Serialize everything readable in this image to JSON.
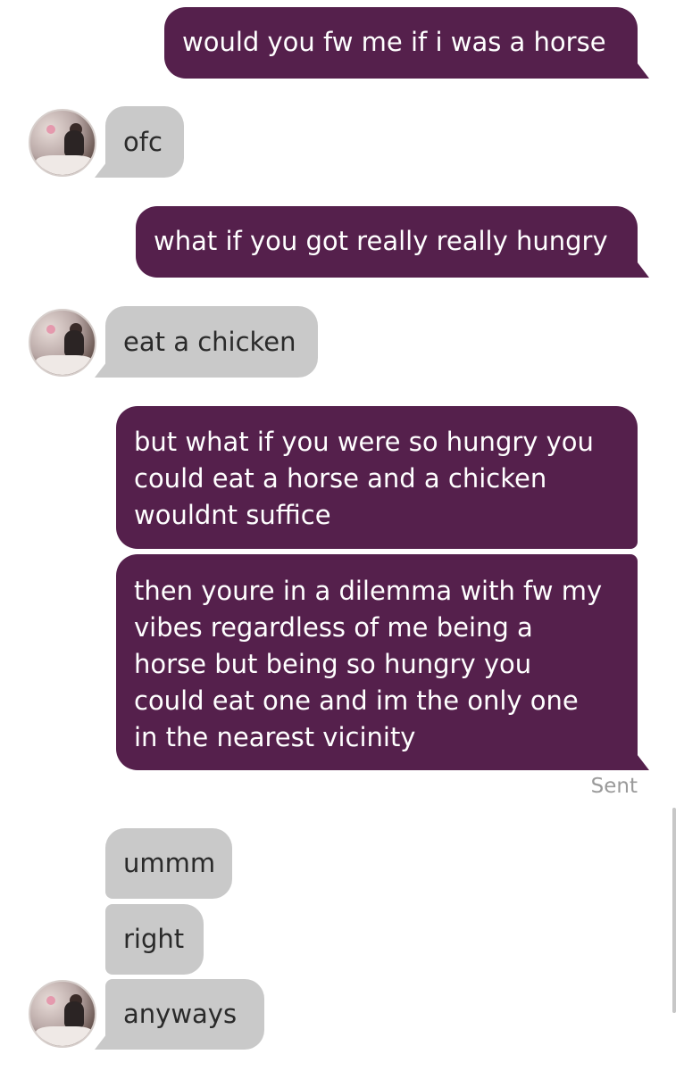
{
  "messages": [
    {
      "from": "me",
      "text": "would you fw me if i was a horse"
    },
    {
      "from": "them",
      "text": "ofc"
    },
    {
      "from": "me",
      "text": "what if you got really really hungry"
    },
    {
      "from": "them",
      "text": "eat a chicken"
    },
    {
      "from": "me",
      "text": "but what if you were so hungry you\ncould eat a horse and a chicken\nwouldnt suffice"
    },
    {
      "from": "me",
      "text": "then youre in a dilemma with fw my\nvibes regardless of me being a\nhorse but being so hungry you\ncould eat one and im the only one\nin the nearest vicinity"
    },
    {
      "from": "them",
      "text": "ummm"
    },
    {
      "from": "them",
      "text": "right"
    },
    {
      "from": "them",
      "text": "anyways"
    }
  ],
  "status": {
    "delivery": "Sent"
  },
  "colors": {
    "outgoing": "#55204c",
    "incoming": "#c9c9c9",
    "background": "#ffffff"
  },
  "icons": {
    "avatar": "contact-avatar-photo"
  }
}
